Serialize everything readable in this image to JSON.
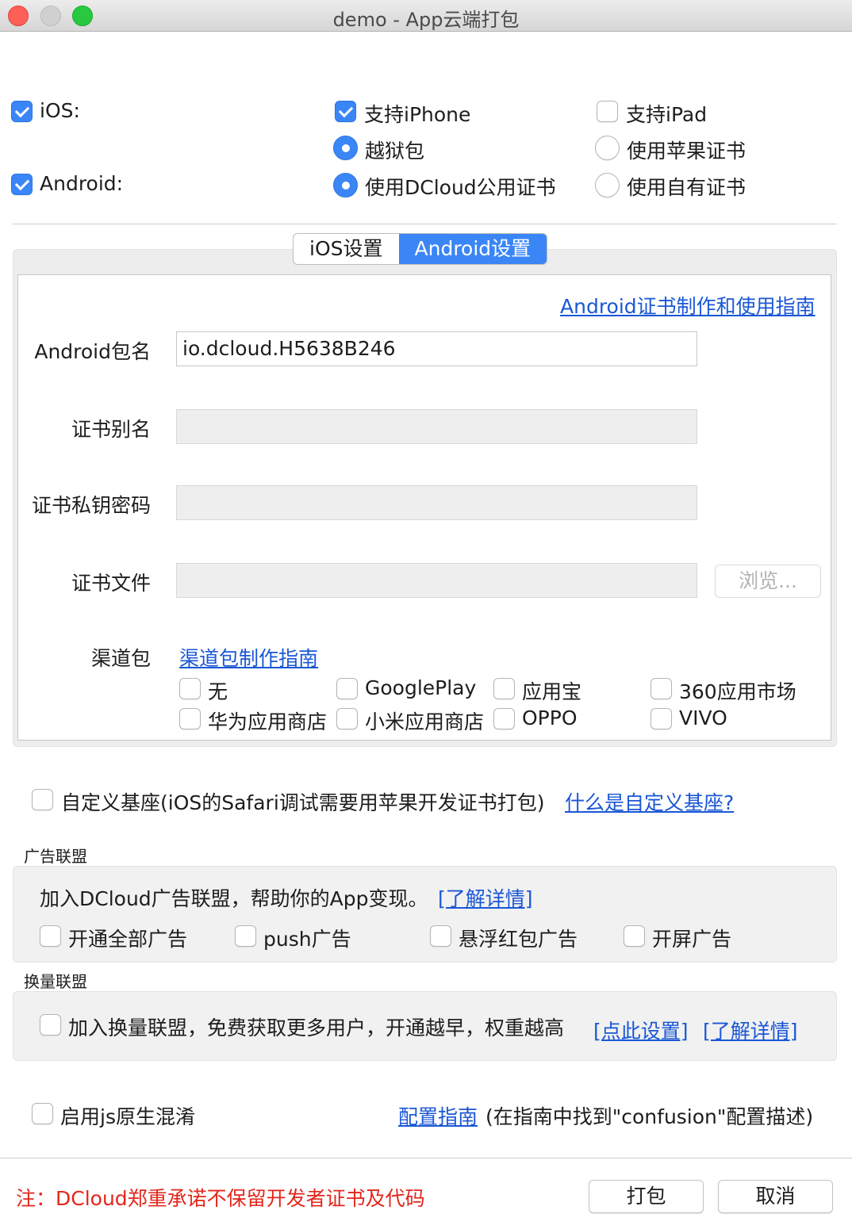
{
  "window": {
    "title": "demo - App云端打包"
  },
  "platforms": {
    "ios_label": "iOS:",
    "ios_checked": true,
    "android_label": "Android:",
    "android_checked": true,
    "support_iphone": "支持iPhone",
    "support_iphone_checked": true,
    "support_ipad": "支持iPad",
    "support_ipad_checked": false,
    "jailbreak": "越狱包",
    "apple_cert": "使用苹果证书",
    "dcloud_cert": "使用DCloud公用证书",
    "own_cert": "使用自有证书"
  },
  "tabs": [
    {
      "label": "iOS设置",
      "active": false
    },
    {
      "label": "Android设置",
      "active": true
    }
  ],
  "android": {
    "guide_link": "Android证书制作和使用指南",
    "package_label": "Android包名",
    "package_value": "io.dcloud.H5638B246",
    "alias_label": "证书别名",
    "alias_value": "",
    "password_label": "证书私钥密码",
    "password_value": "",
    "file_label": "证书文件",
    "file_value": "",
    "browse_label": "浏览...",
    "channel_label": "渠道包",
    "channel_guide": "渠道包制作指南",
    "channels": [
      "无",
      "GooglePlay",
      "应用宝",
      "360应用市场",
      "华为应用商店",
      "小米应用商店",
      "OPPO",
      "VIVO"
    ]
  },
  "custom_base": {
    "label": "自定义基座(iOS的Safari调试需要用苹果开发证书打包)",
    "link": "什么是自定义基座?"
  },
  "ads": {
    "section": "广告联盟",
    "intro": "加入DCloud广告联盟，帮助你的App变现。",
    "learn_more": "[了解详情]",
    "options": [
      "开通全部广告",
      "push广告",
      "悬浮红包广告",
      "开屏广告"
    ]
  },
  "exchange": {
    "section": "换量联盟",
    "label": "加入换量联盟，免费获取更多用户，开通越早，权重越高",
    "set_link": "[点此设置]",
    "learn_more": "[了解详情]"
  },
  "obfuscation": {
    "label": "启用js原生混淆",
    "guide_link": "配置指南",
    "guide_note": "(在指南中找到\"confusion\"配置描述)"
  },
  "footer": {
    "notice": "注：DCloud郑重承诺不保留开发者证书及代码",
    "pack_button": "打包",
    "cancel_button": "取消"
  },
  "colors": {
    "accent": "#3b86f6",
    "link": "#1a57d6",
    "notice": "#e3261c"
  }
}
